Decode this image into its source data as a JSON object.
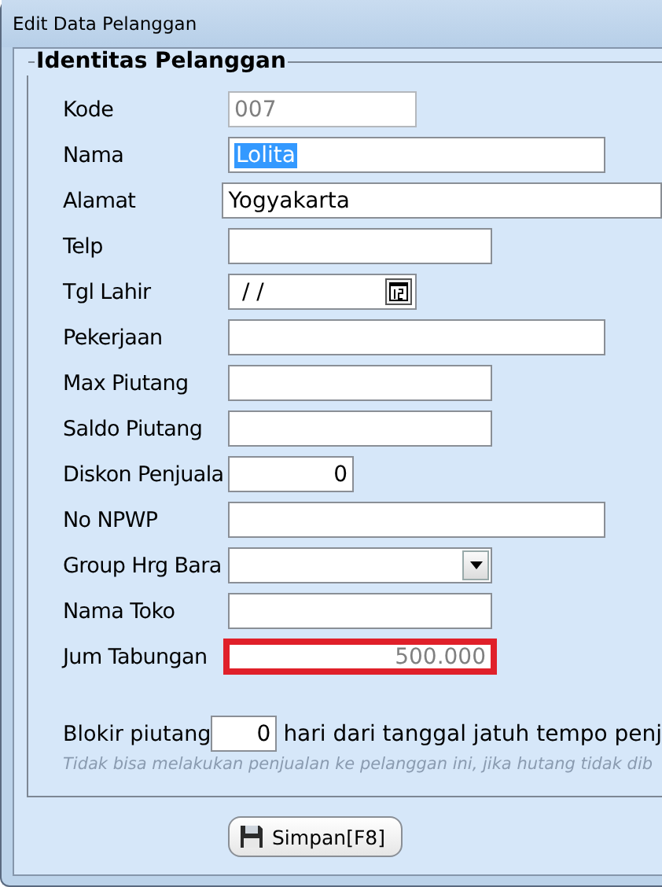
{
  "window": {
    "title": "Edit Data Pelanggan"
  },
  "group": {
    "title": "Identitas Pelanggan"
  },
  "fields": [
    {
      "label": "Kode",
      "kind": "text",
      "value": "007",
      "disabled": true,
      "selected": false,
      "highlighted": false
    },
    {
      "label": "Nama",
      "kind": "text",
      "value": "Lolita",
      "disabled": false,
      "selected": true,
      "highlighted": false
    },
    {
      "label": "Alamat",
      "kind": "text",
      "value": "Yogyakarta",
      "disabled": false,
      "selected": false,
      "highlighted": false
    },
    {
      "label": "Telp",
      "kind": "text",
      "disabled": false,
      "selected": false,
      "highlighted": false
    },
    {
      "label": "Tgl Lahir",
      "kind": "date",
      "value": " /  /",
      "disabled": false,
      "selected": false,
      "highlighted": false
    },
    {
      "label": "Pekerjaan",
      "kind": "text",
      "disabled": false,
      "selected": false,
      "highlighted": false
    },
    {
      "label": "Max Piutang",
      "kind": "text",
      "disabled": false,
      "selected": false,
      "highlighted": false
    },
    {
      "label": "Saldo Piutang",
      "kind": "text",
      "disabled": false,
      "selected": false,
      "highlighted": false
    },
    {
      "label": "Diskon Penjuala",
      "kind": "number",
      "value": "0",
      "disabled": false,
      "selected": false,
      "highlighted": false
    },
    {
      "label": "No NPWP",
      "kind": "text",
      "disabled": false,
      "selected": false,
      "highlighted": false
    },
    {
      "label": "Group Hrg Bara",
      "kind": "dropdown",
      "disabled": false,
      "selected": false,
      "highlighted": false
    },
    {
      "label": "Nama Toko",
      "kind": "text",
      "disabled": false,
      "selected": false,
      "highlighted": false
    },
    {
      "label": "Jum Tabungan",
      "kind": "number",
      "value": "500.000",
      "disabled": true,
      "selected": false,
      "highlighted": true
    }
  ],
  "blokir": {
    "label": "Blokir piutang",
    "value": "0",
    "suffix": "hari dari tanggal jatuh tempo penj",
    "note": "Tidak bisa melakukan penjualan ke pelanggan ini, jika hutang tidak dib"
  },
  "buttons": [
    {
      "label": "Simpan[F8]"
    }
  ]
}
